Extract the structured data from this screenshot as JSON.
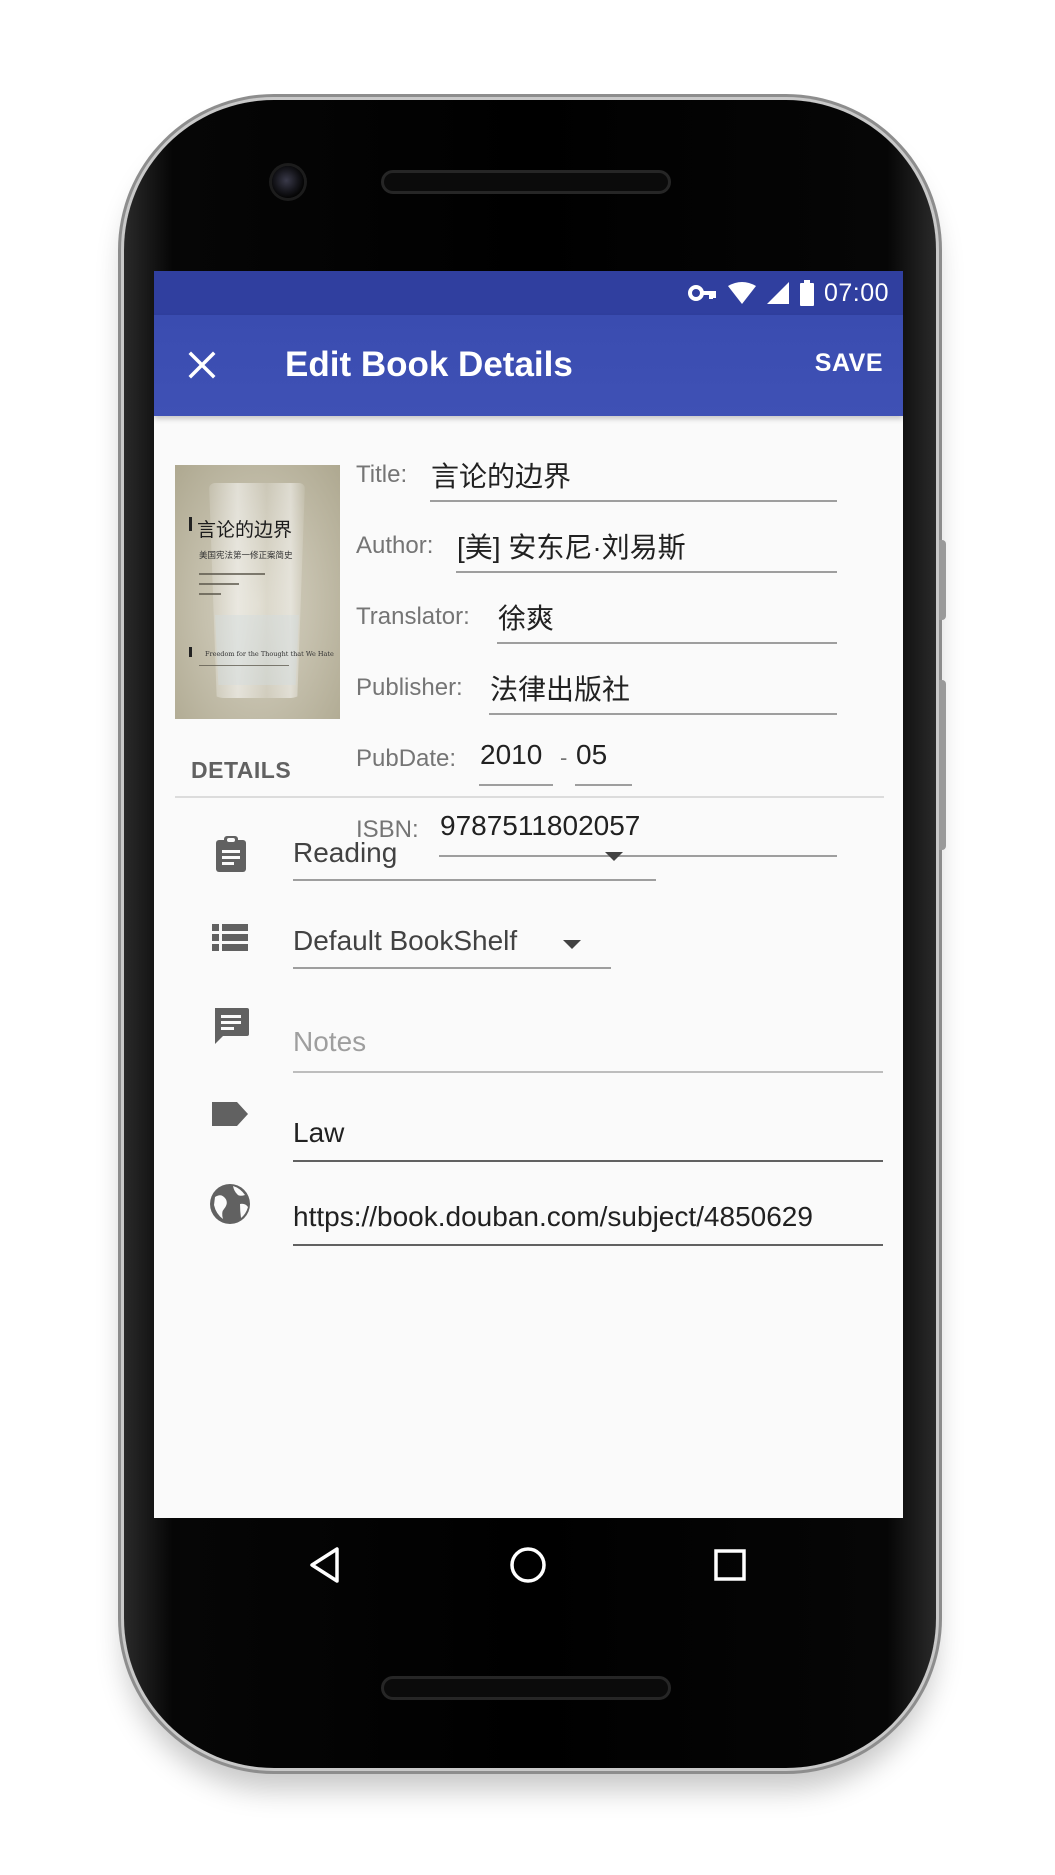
{
  "status": {
    "time": "07:00",
    "icons": [
      "vpn-key-icon",
      "wifi-icon",
      "cell-signal-icon",
      "battery-icon"
    ]
  },
  "appbar": {
    "title": "Edit Book Details",
    "close_icon": "close-icon",
    "save_label": "SAVE",
    "color": "#3f51b5",
    "status_color": "#303f9f"
  },
  "cover": {
    "title": "言论的边界",
    "subtitle": "美国宪法第一修正案简史",
    "english": "Freedom for the Thought that We Hate"
  },
  "fields": {
    "title": {
      "label": "Title:",
      "value": "言论的边界"
    },
    "author": {
      "label": "Author:",
      "value": "[美] 安东尼·刘易斯"
    },
    "translator": {
      "label": "Translator:",
      "value": "徐爽"
    },
    "publisher": {
      "label": "Publisher:",
      "value": "法律出版社"
    },
    "pubdate": {
      "label": "PubDate:",
      "year": "2010",
      "separator": "-",
      "month": "05"
    },
    "isbn": {
      "label": "ISBN:",
      "value": "9787511802057"
    }
  },
  "details": {
    "header": "DETAILS",
    "status_select": {
      "icon": "clipboard-icon",
      "value": "Reading"
    },
    "shelf_select": {
      "icon": "list-icon",
      "value": "Default BookShelf"
    },
    "notes": {
      "icon": "comment-icon",
      "placeholder": "Notes"
    },
    "tags": {
      "icon": "label-icon",
      "value": "Law"
    },
    "url": {
      "icon": "globe-icon",
      "value": "https://book.douban.com/subject/4850629"
    }
  },
  "navigation": {
    "back": "back-icon",
    "home": "home-icon",
    "recents": "recents-icon"
  }
}
